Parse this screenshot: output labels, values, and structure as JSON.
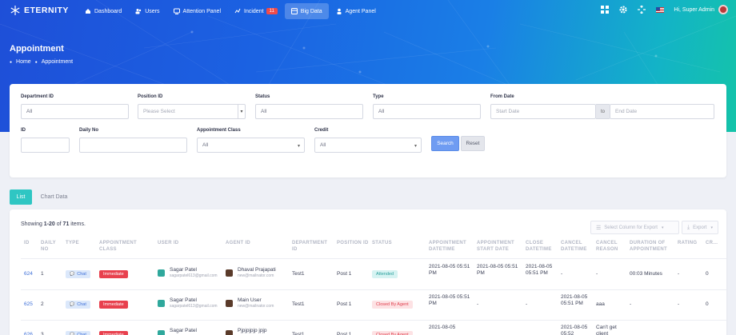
{
  "brand": {
    "name": "ETERNITY"
  },
  "nav": [
    {
      "label": "Dashboard",
      "icon": "home-icon"
    },
    {
      "label": "Users",
      "icon": "users-icon"
    },
    {
      "label": "Attention Panel",
      "icon": "attention-icon"
    },
    {
      "label": "Incident",
      "icon": "incident-icon",
      "badge": "11"
    },
    {
      "label": "Big Data",
      "icon": "bigdata-icon",
      "active": true
    },
    {
      "label": "Agent Panel",
      "icon": "agent-icon"
    }
  ],
  "user": {
    "greeting": "Hi, Super Admin"
  },
  "page": {
    "title": "Appointment",
    "breadcrumb": [
      "Home",
      "Appointment"
    ]
  },
  "filters": {
    "department_id": {
      "label": "Department ID",
      "value": "All"
    },
    "position_id": {
      "label": "Position ID",
      "value": "Please Select"
    },
    "status": {
      "label": "Status",
      "value": "All"
    },
    "type": {
      "label": "Type",
      "value": "All"
    },
    "from_date": {
      "label": "From Date",
      "start_placeholder": "Start Date",
      "to": "to",
      "end_placeholder": "End Date"
    },
    "id": {
      "label": "ID",
      "value": ""
    },
    "daily_no": {
      "label": "Daily No",
      "value": ""
    },
    "appointment_class": {
      "label": "Appointment Class",
      "value": "All"
    },
    "credit": {
      "label": "Credit",
      "value": "All"
    },
    "search_label": "Search",
    "reset_label": "Reset"
  },
  "tabs": [
    {
      "label": "List",
      "active": true
    },
    {
      "label": "Chart Data",
      "active": false
    }
  ],
  "summary": {
    "prefix": "Showing ",
    "range": "1-20",
    "mid": " of ",
    "total": "71",
    "suffix": " items."
  },
  "export": {
    "select_columns": "Select Column for Export",
    "export": "Export"
  },
  "columns": [
    "ID",
    "Daily No",
    "Type",
    "Appointment Class",
    "User ID",
    "Agent ID",
    "Department ID",
    "Position ID",
    "Status",
    "Appointment Datetime",
    "Appointment Start Date",
    "Close Datetime",
    "Cancel Datetime",
    "Cancel Reason",
    "Duration of Appointment",
    "Rating",
    "Cr..."
  ],
  "rows": [
    {
      "id": "624",
      "daily_no": "1",
      "type": "Chat",
      "class": "Immediate",
      "user": {
        "name": "Sagar Patel",
        "email": "sagarpatel613@gmail.com"
      },
      "agent": {
        "name": "Dhaval Prajapati",
        "email": "new@mailnator.com"
      },
      "department": "Test1",
      "position": "Post 1",
      "status": "Attended",
      "status_kind": "attended",
      "appt_dt": "2021-08-05 05:51 PM",
      "start_dt": "2021-08-05 05:51 PM",
      "close_dt": "2021-08-05 05:51 PM",
      "cancel_dt": "-",
      "cancel_reason": "-",
      "duration": "00:03 Minutes",
      "rating": "-",
      "credit": "0"
    },
    {
      "id": "625",
      "daily_no": "2",
      "type": "Chat",
      "class": "Immediate",
      "user": {
        "name": "Sagar Patel",
        "email": "sagarpatel613@gmail.com"
      },
      "agent": {
        "name": "Main User",
        "email": "new@mailnator.com"
      },
      "department": "Test1",
      "position": "Post 1",
      "status": "Closed By Agent",
      "status_kind": "closed",
      "appt_dt": "2021-08-05 05:51 PM",
      "start_dt": "-",
      "close_dt": "-",
      "cancel_dt": "2021-08-05 05:51 PM",
      "cancel_reason": "aaa",
      "duration": "-",
      "rating": "-",
      "credit": "0"
    },
    {
      "id": "626",
      "daily_no": "3",
      "type": "Chat",
      "class": "Immediate",
      "user": {
        "name": "Sagar Patel",
        "email": ""
      },
      "agent": {
        "name": "Pjpjpjpjp jpjp",
        "email": ""
      },
      "department": "Test1",
      "position": "Post 1",
      "status": "Closed By Agent",
      "status_kind": "closed",
      "appt_dt": "2021-08-05",
      "start_dt": "",
      "close_dt": "",
      "cancel_dt": "2021-08-05 05:52",
      "cancel_reason": "Can't get client",
      "duration": "",
      "rating": "",
      "credit": ""
    }
  ]
}
